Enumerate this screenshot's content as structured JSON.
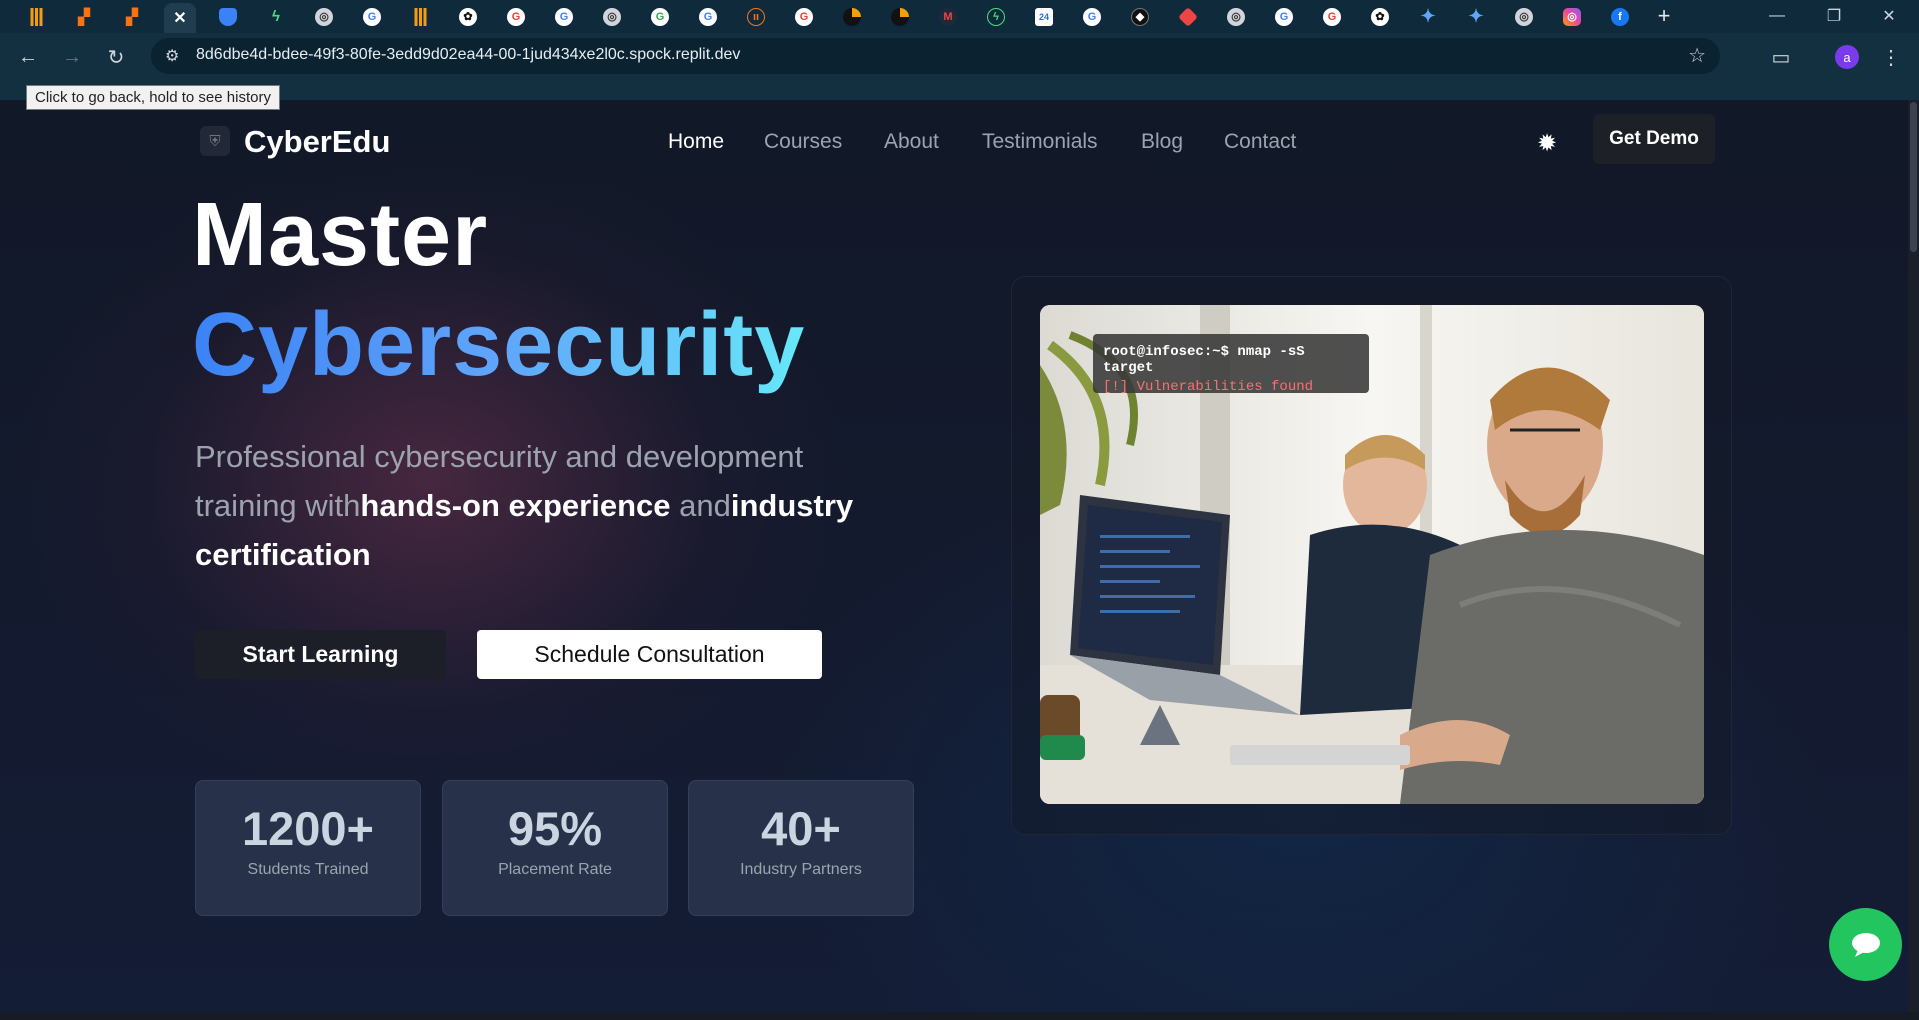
{
  "browser": {
    "url": "8d6dbe4d-bdee-49f3-80fe-3edd9d02ea44-00-1jud434xe2l0c.spock.replit.dev",
    "tooltip": "Click to go back, hold to see history",
    "tab_icons": [
      "analytics-icon",
      "apps-icon",
      "apps-icon",
      "close-icon",
      "shield-icon",
      "bolt-icon",
      "chrome-icon",
      "google-icon",
      "analytics-icon",
      "openai-icon",
      "google-icon",
      "google-icon",
      "chrome-icon",
      "google-icon",
      "google-icon",
      "ai-icon",
      "google-icon",
      "site-icon",
      "site-icon",
      "gmail-icon",
      "bolt-icon",
      "calendar-icon",
      "google-icon",
      "site-icon",
      "git-icon",
      "chrome-icon",
      "google-icon",
      "google-icon",
      "openai-icon",
      "gemini-icon",
      "gemini-icon",
      "chrome-icon",
      "instagram-icon",
      "facebook-icon"
    ],
    "profile_initial": "a"
  },
  "site": {
    "brand": "CyberEdu",
    "nav": [
      "Home",
      "Courses",
      "About",
      "Testimonials",
      "Blog",
      "Contact"
    ],
    "active_nav": "Home",
    "cta": "Get Demo"
  },
  "hero": {
    "line1": "Master",
    "line2": "Cybersecurity",
    "subtitle_1": "Professional cybersecurity and development training with",
    "subtitle_hl1": "hands-on experience",
    "subtitle_2": " and",
    "subtitle_hl2": "industry certification",
    "btn_start": "Start Learning",
    "btn_consult": "Schedule Consultation"
  },
  "stats": [
    {
      "value": "1200+",
      "label": "Students Trained"
    },
    {
      "value": "95%",
      "label": "Placement Rate"
    },
    {
      "value": "40+",
      "label": "Industry Partners"
    }
  ],
  "terminal": {
    "command": "root@infosec:~$ nmap -sS target",
    "alert": "[!] Vulnerabilities found"
  },
  "colors": {
    "accent_start": "#3b82f6",
    "accent_end": "#67e8f9",
    "chat": "#22c55e"
  }
}
